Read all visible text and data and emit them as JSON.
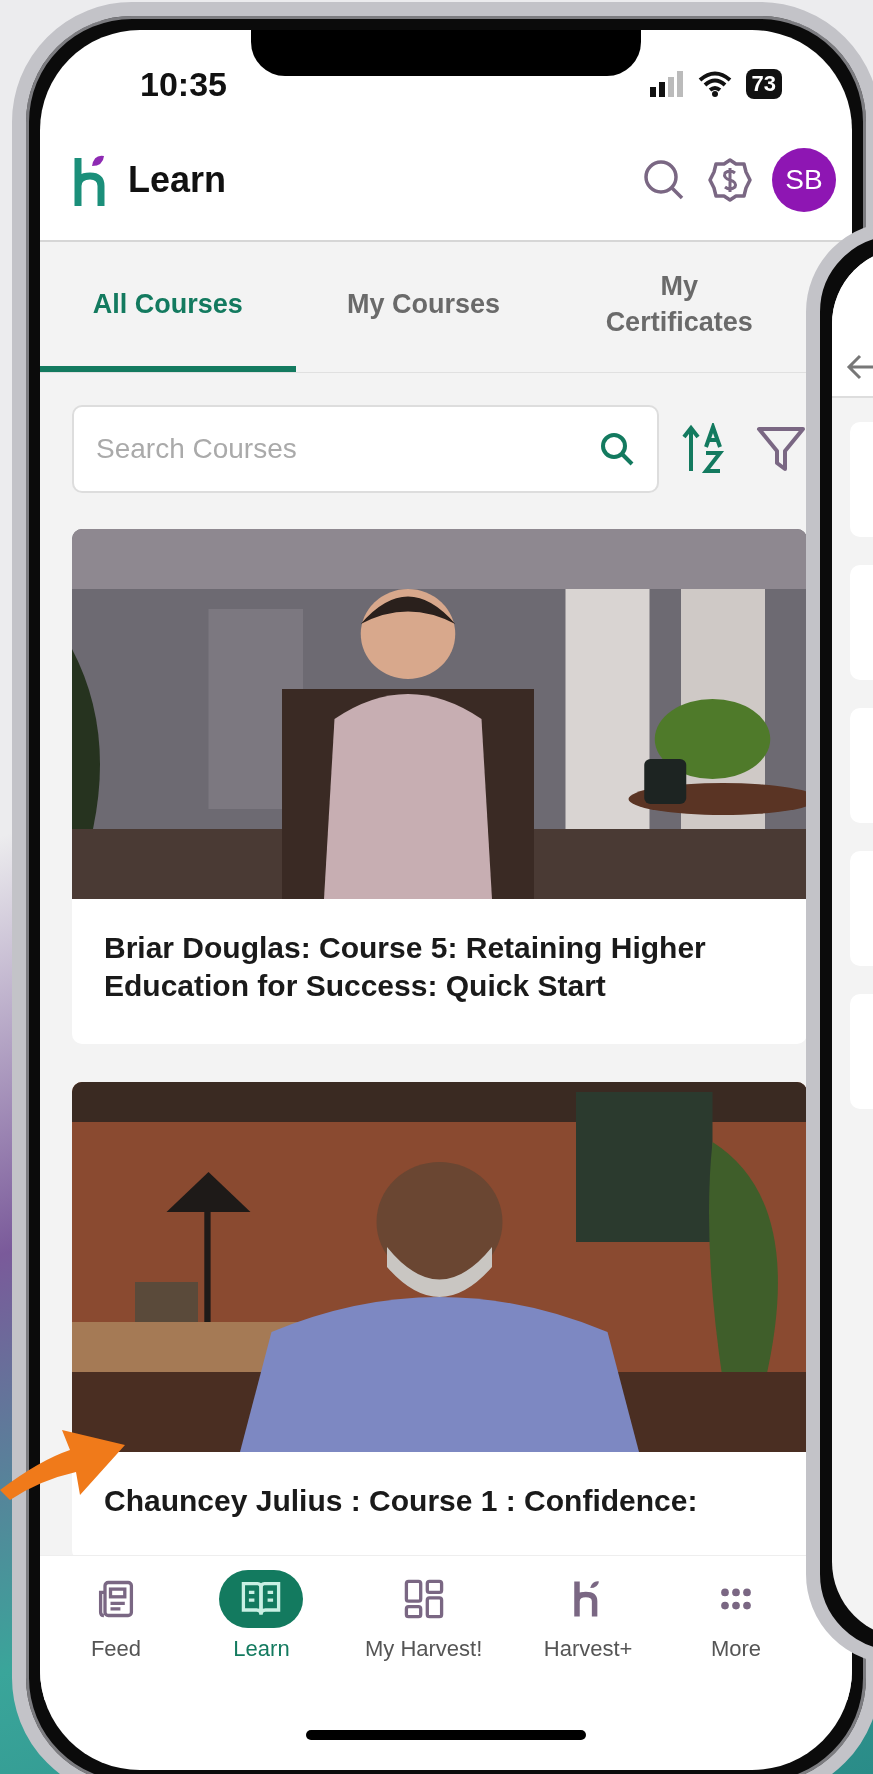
{
  "status_bar": {
    "time": "10:35",
    "battery": "73"
  },
  "header": {
    "title": "Learn",
    "avatar": "SB"
  },
  "tabs": [
    {
      "label": "All Courses",
      "selected": true
    },
    {
      "label": "My Courses",
      "selected": false
    },
    {
      "label": "My Certificates",
      "selected": false
    }
  ],
  "search": {
    "placeholder": "Search Courses"
  },
  "courses": [
    {
      "title": "Briar Douglas: Course 5: Retaining Higher Education for Success: Quick Start"
    },
    {
      "title": "Chauncey Julius : Course 1 : Confidence:"
    }
  ],
  "bottom_nav": [
    {
      "label": "Feed",
      "selected": false
    },
    {
      "label": "Learn",
      "selected": true
    },
    {
      "label": "My Harvest!",
      "selected": false
    },
    {
      "label": "Harvest+",
      "selected": false
    },
    {
      "label": "More",
      "selected": false
    }
  ]
}
